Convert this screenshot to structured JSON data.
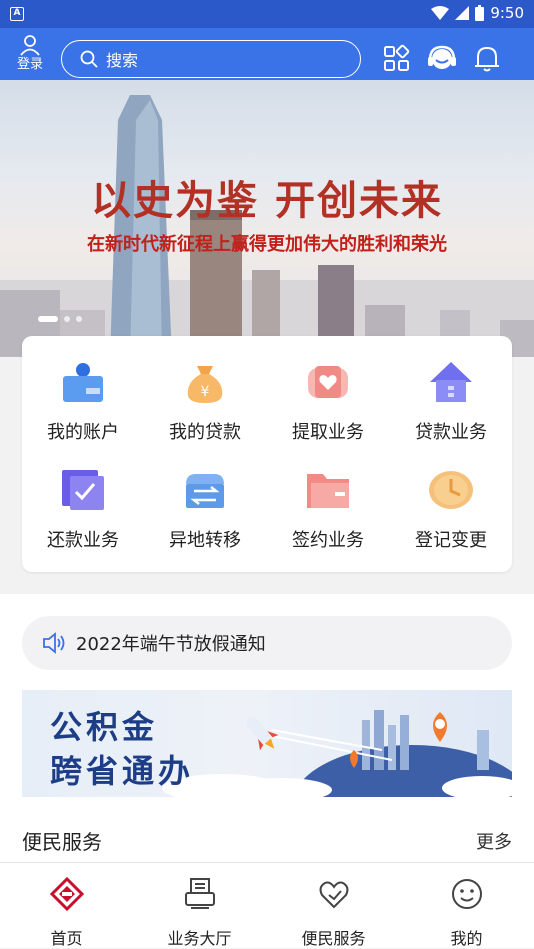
{
  "status_bar": {
    "time": "9:50"
  },
  "header": {
    "login_label": "登录",
    "search_placeholder": "搜索",
    "icons": [
      "grid-icon",
      "customer-service-icon",
      "bell-icon"
    ]
  },
  "banner": {
    "title": "以史为鉴  开创未来",
    "subtitle": "在新时代新征程上赢得更加伟大的胜利和荣光",
    "slide_count": 3,
    "active_slide": 1
  },
  "quick_services": [
    {
      "label": "我的账户",
      "icon": "account-card-icon"
    },
    {
      "label": "我的贷款",
      "icon": "money-bag-icon"
    },
    {
      "label": "提取业务",
      "icon": "heart-withdraw-icon"
    },
    {
      "label": "贷款业务",
      "icon": "house-icon"
    },
    {
      "label": "还款业务",
      "icon": "repay-check-icon"
    },
    {
      "label": "异地转移",
      "icon": "transfer-icon"
    },
    {
      "label": "签约业务",
      "icon": "folder-icon"
    },
    {
      "label": "登记变更",
      "icon": "clock-icon"
    }
  ],
  "notice": {
    "text": "2022年端午节放假通知"
  },
  "promo": {
    "line1": "公积金",
    "line2": "跨省通办"
  },
  "services_section": {
    "title": "便民服务",
    "more": "更多"
  },
  "tabbar": [
    {
      "label": "首页",
      "icon": "home-logo-icon",
      "active": true
    },
    {
      "label": "业务大厅",
      "icon": "printer-icon",
      "active": false
    },
    {
      "label": "便民服务",
      "icon": "heart-hand-icon",
      "active": false
    },
    {
      "label": "我的",
      "icon": "smile-icon",
      "active": false
    }
  ],
  "colors": {
    "brand": "#3a72e8",
    "status_bar": "#2c59c9",
    "banner_title": "#b33024",
    "tab_active": "#c8102e"
  }
}
